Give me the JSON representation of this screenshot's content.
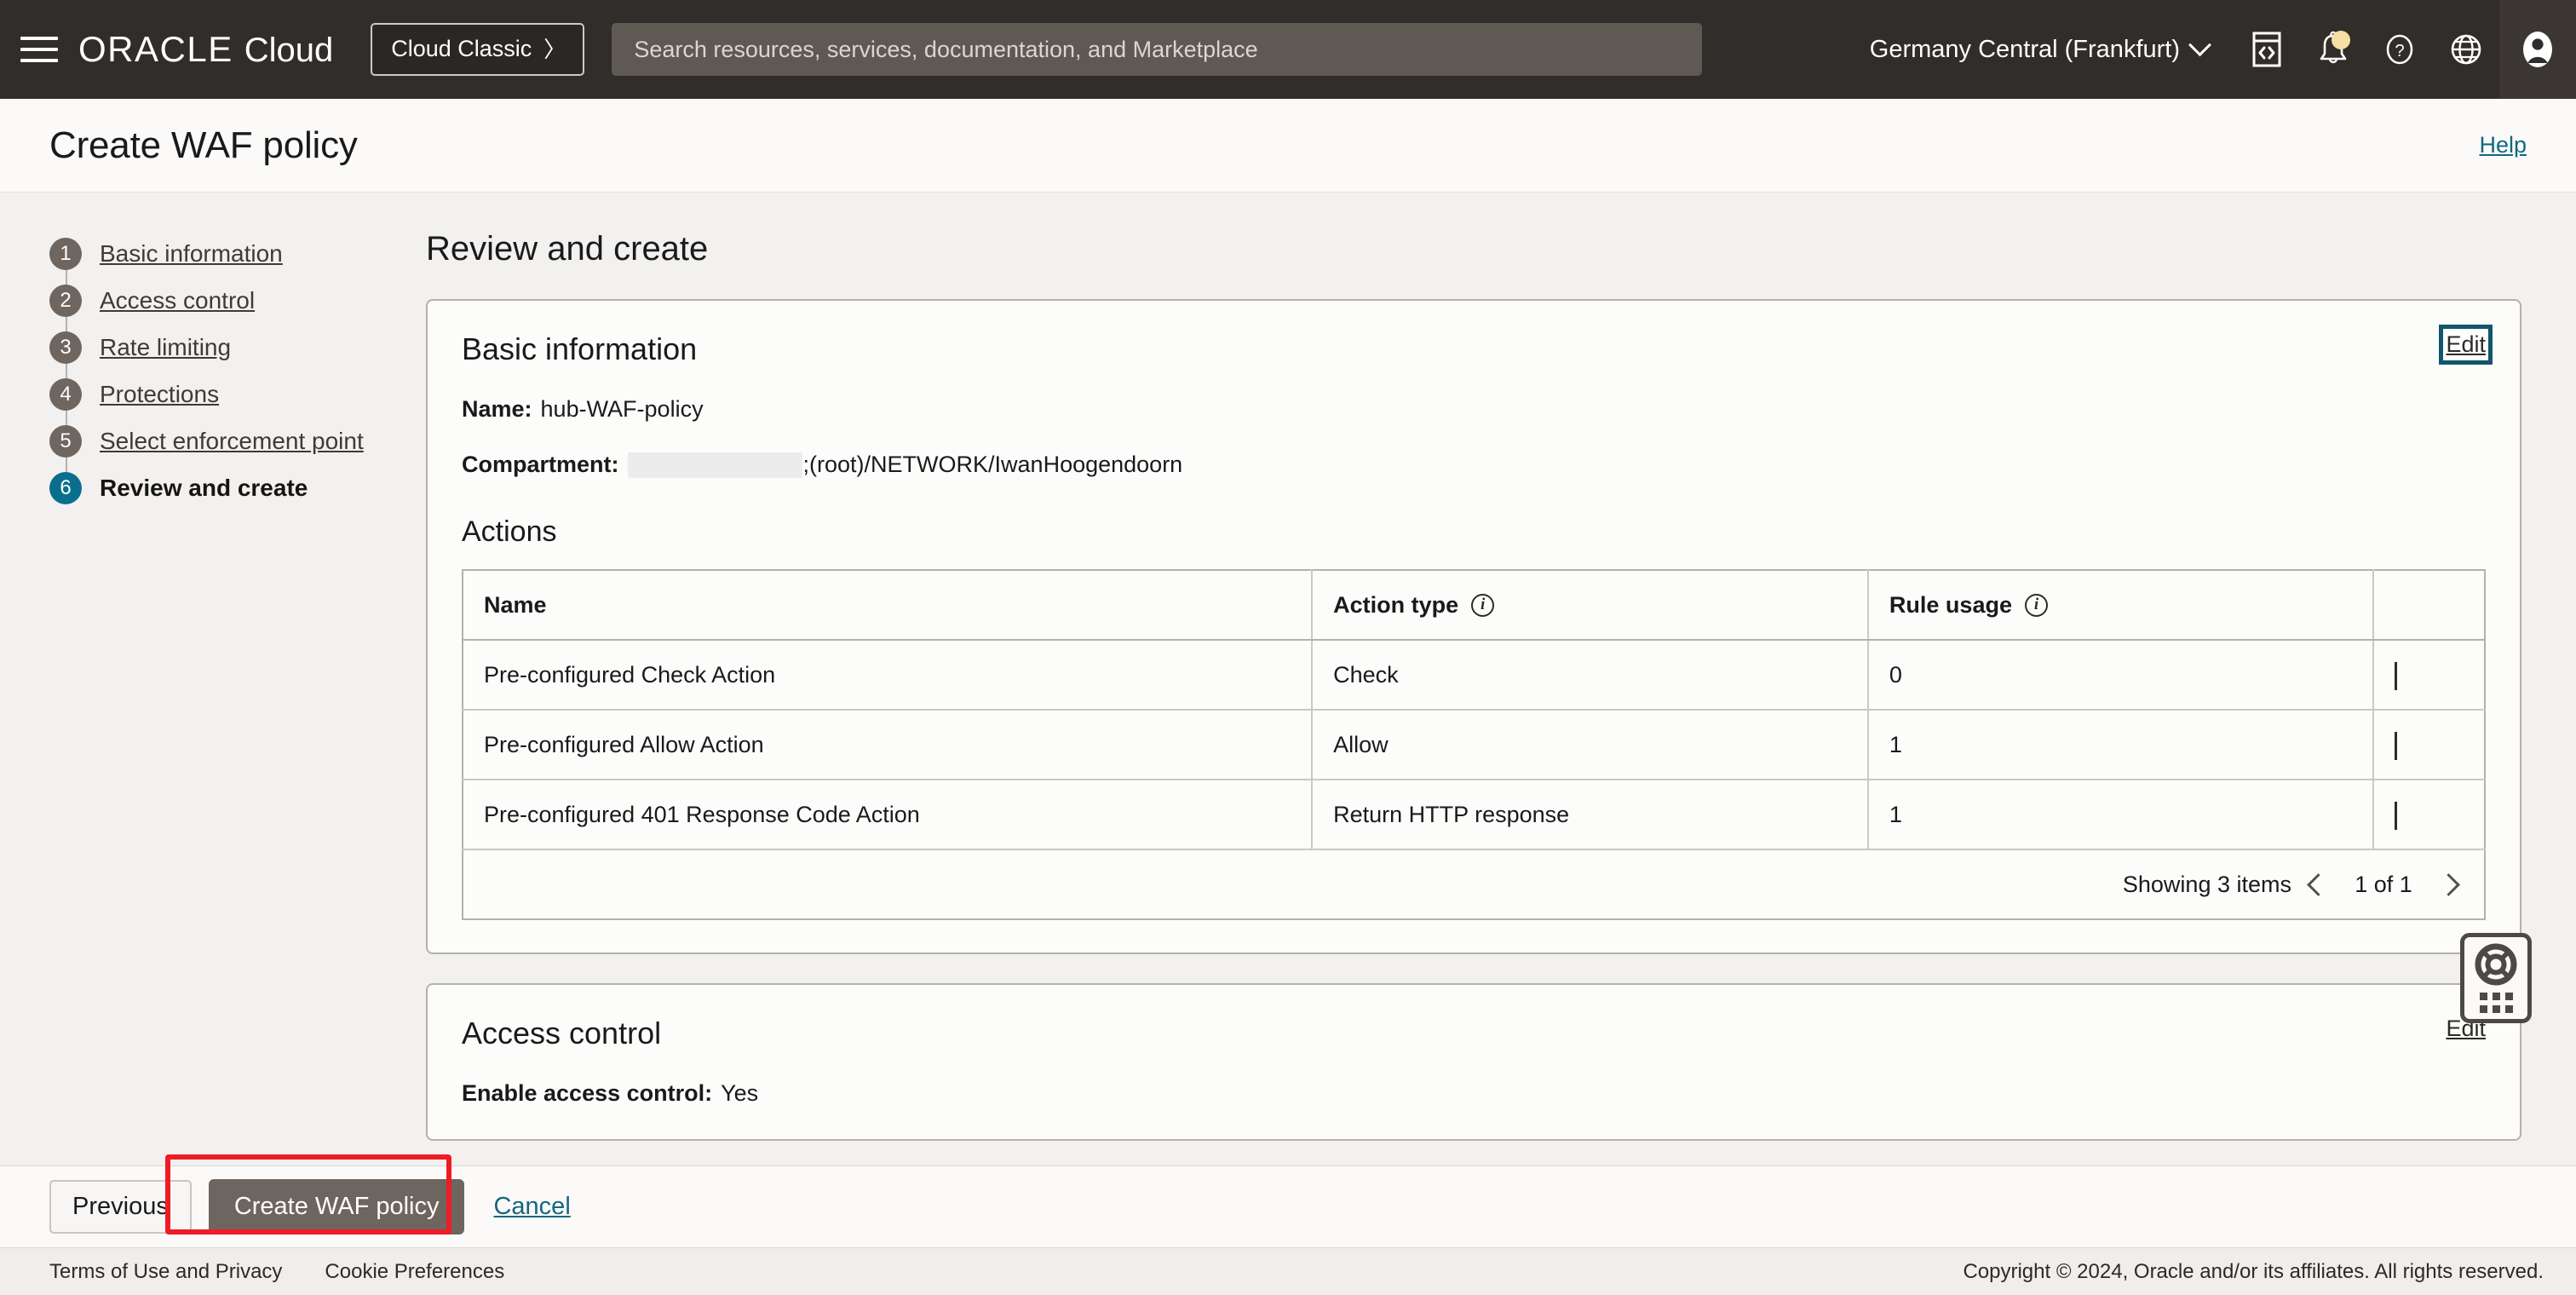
{
  "topnav": {
    "menu_icon": "hamburger-icon",
    "brand_oracle": "ORACLE",
    "brand_cloud": "Cloud",
    "cloud_classic_label": "Cloud Classic",
    "cloud_classic_chevron": "〉",
    "search_placeholder": "Search resources, services, documentation, and Marketplace",
    "search_value": "",
    "region": "Germany Central (Frankfurt)",
    "icons": [
      "cloud-shell-icon",
      "notifications-bell-icon",
      "help-question-icon",
      "language-globe-icon",
      "user-avatar-icon"
    ],
    "notification_badge_color": "#f5dfa4",
    "background_color": "#312d2a"
  },
  "pagehead": {
    "title": "Create WAF policy",
    "help_label": "Help",
    "help_color": "#12687f"
  },
  "steps": [
    {
      "num": "1",
      "label": "Basic information",
      "current": false
    },
    {
      "num": "2",
      "label": "Access control",
      "current": false
    },
    {
      "num": "3",
      "label": "Rate limiting",
      "current": false
    },
    {
      "num": "4",
      "label": "Protections",
      "current": false
    },
    {
      "num": "5",
      "label": "Select enforcement point",
      "current": false
    },
    {
      "num": "6",
      "label": "Review and create",
      "current": true
    }
  ],
  "step_colors": {
    "inactive": "#6e665f",
    "current": "#0a6f8f"
  },
  "main": {
    "heading": "Review and create",
    "basic_information": {
      "title": "Basic information",
      "edit_label": "Edit",
      "edit_focused": true,
      "fields": [
        {
          "label": "Name:",
          "value": "hub-WAF-policy",
          "redacted": false
        },
        {
          "label": "Compartment:",
          "value": "(root)/NETWORK/IwanHoogendoorn",
          "redacted": true,
          "redacted_suffix": ";"
        }
      ],
      "actions_section": {
        "title": "Actions",
        "columns": [
          {
            "label": "Name",
            "info": false
          },
          {
            "label": "Action type",
            "info": true
          },
          {
            "label": "Rule usage",
            "info": true
          },
          {
            "label": "",
            "info": false
          }
        ],
        "rows": [
          {
            "name": "Pre-configured Check Action",
            "type": "Check",
            "usage": "0"
          },
          {
            "name": "Pre-configured Allow Action",
            "type": "Allow",
            "usage": "1"
          },
          {
            "name": "Pre-configured 401 Response Code Action",
            "type": "Return HTTP response",
            "usage": "1"
          }
        ],
        "pagination": {
          "showing": "Showing 3 items",
          "page_label": "1 of 1",
          "prev_icon": "chevron-left-icon",
          "next_icon": "chevron-right-icon"
        }
      }
    },
    "access_control": {
      "title": "Access control",
      "edit_label": "Edit",
      "fields": [
        {
          "label": "Enable access control:",
          "value": "Yes"
        }
      ]
    }
  },
  "support_widget": {
    "icon": "lifebuoy-icon",
    "drag_handle": "dots-grid-icon"
  },
  "actionbar": {
    "previous_label": "Previous",
    "primary_label": "Create WAF policy",
    "cancel_label": "Cancel",
    "annotation_color": "#ee1c25",
    "primary_color": "#6d6560"
  },
  "footer": {
    "terms_label": "Terms of Use and Privacy",
    "cookies_label": "Cookie Preferences",
    "copyright": "Copyright © 2024, Oracle and/or its affiliates. All rights reserved."
  }
}
